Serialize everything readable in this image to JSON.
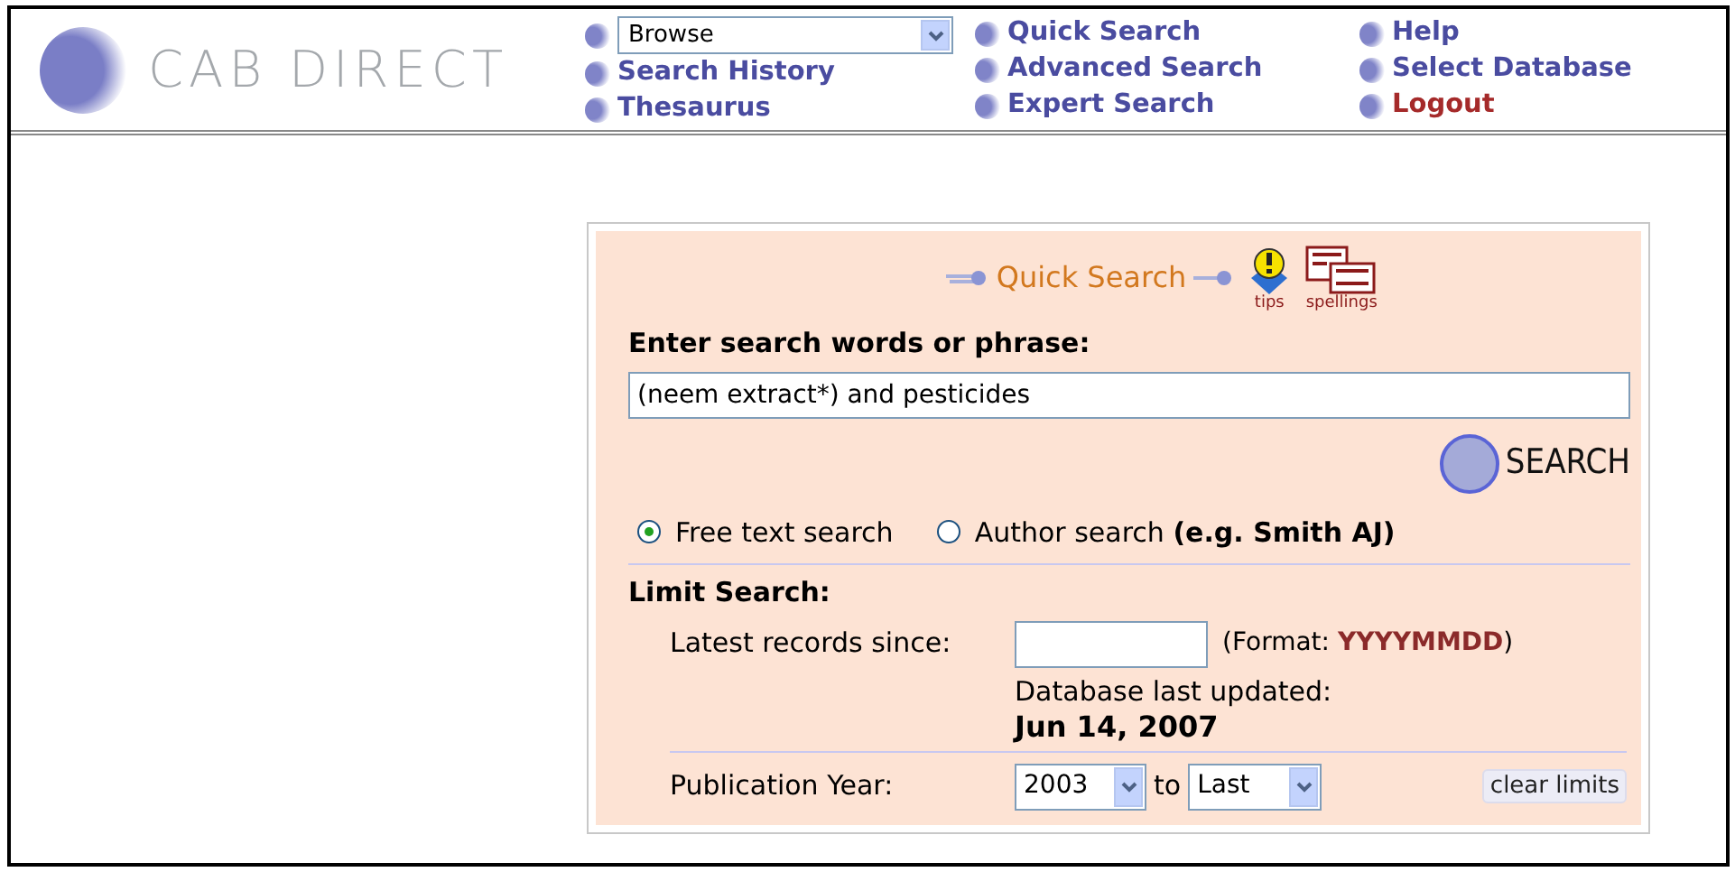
{
  "header": {
    "logo_text": "CAB DIRECT",
    "browse_select": {
      "value": "Browse"
    },
    "nav_links": [
      {
        "label": "Search History",
        "kind": "link"
      },
      {
        "label": "Thesaurus",
        "kind": "link"
      },
      {
        "label": "Quick Search",
        "kind": "link"
      },
      {
        "label": "Advanced Search",
        "kind": "link"
      },
      {
        "label": "Expert Search",
        "kind": "link"
      },
      {
        "label": "Help",
        "kind": "link"
      },
      {
        "label": "Select Database",
        "kind": "link"
      },
      {
        "label": "Logout",
        "kind": "logout"
      }
    ]
  },
  "search_panel": {
    "title": "Quick Search",
    "tools": [
      {
        "label": "tips",
        "kind": "tips"
      },
      {
        "label": "spellings",
        "kind": "spellings"
      }
    ],
    "prompt": "Enter search words or phrase:",
    "query": "(neem extract*) and pesticides",
    "search_button": "SEARCH",
    "modes": [
      {
        "label": "Free text search",
        "selected": true
      },
      {
        "label": "Author search **(e.g. Smith AJ)**",
        "selected": false
      }
    ],
    "limit_heading": "Limit Search:",
    "latest_label": "Latest records since:",
    "format_prefix": "(Format:",
    "format_value": "YYYYMMDD",
    "format_suffix": ")",
    "updated_label": "Database last updated:",
    "updated_date": "Jun 14, 2007",
    "year_label": "Publication Year:",
    "year_from": "2003",
    "year_to_word": "to",
    "year_to": "Last",
    "clear_button": "clear limits"
  }
}
